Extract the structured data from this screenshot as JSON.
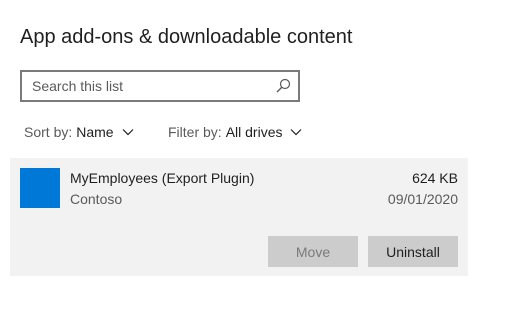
{
  "page": {
    "title": "App add-ons & downloadable content"
  },
  "search": {
    "placeholder": "Search this list",
    "icon": "search-icon"
  },
  "sort": {
    "label": "Sort by:",
    "value": "Name"
  },
  "filter": {
    "label": "Filter by:",
    "value": "All drives"
  },
  "items": [
    {
      "name": "MyEmployees (Export Plugin)",
      "publisher": "Contoso",
      "size": "624 KB",
      "date": "09/01/2020",
      "tile_color": "#0078d7",
      "move_label": "Move",
      "move_enabled": false,
      "uninstall_label": "Uninstall"
    }
  ],
  "colors": {
    "accent": "#0078d7",
    "selected_background": "#f2f2f2",
    "button_background": "#cccccc"
  }
}
